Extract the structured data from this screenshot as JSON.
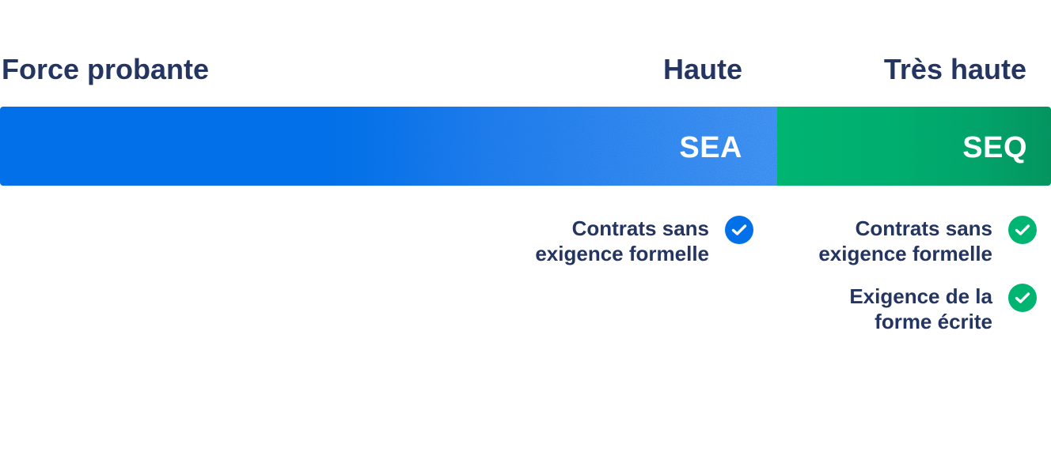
{
  "headings": {
    "left": "Force probante",
    "middle": "Haute",
    "right": "Très haute"
  },
  "bars": {
    "sea": {
      "label": "SEA",
      "color": "#0270e8"
    },
    "seq": {
      "label": "SEQ",
      "color": "#00b472"
    }
  },
  "features": {
    "sea": [
      {
        "text": "Contrats sans\nexigence formelle",
        "icon": "check-circle-icon"
      }
    ],
    "seq": [
      {
        "text": "Contrats sans\nexigence formelle",
        "icon": "check-circle-icon"
      },
      {
        "text": "Exigence de la\nforme écrite",
        "icon": "check-circle-icon"
      }
    ]
  },
  "colors": {
    "text": "#233560",
    "blue": "#0270e8",
    "green": "#00b472"
  }
}
